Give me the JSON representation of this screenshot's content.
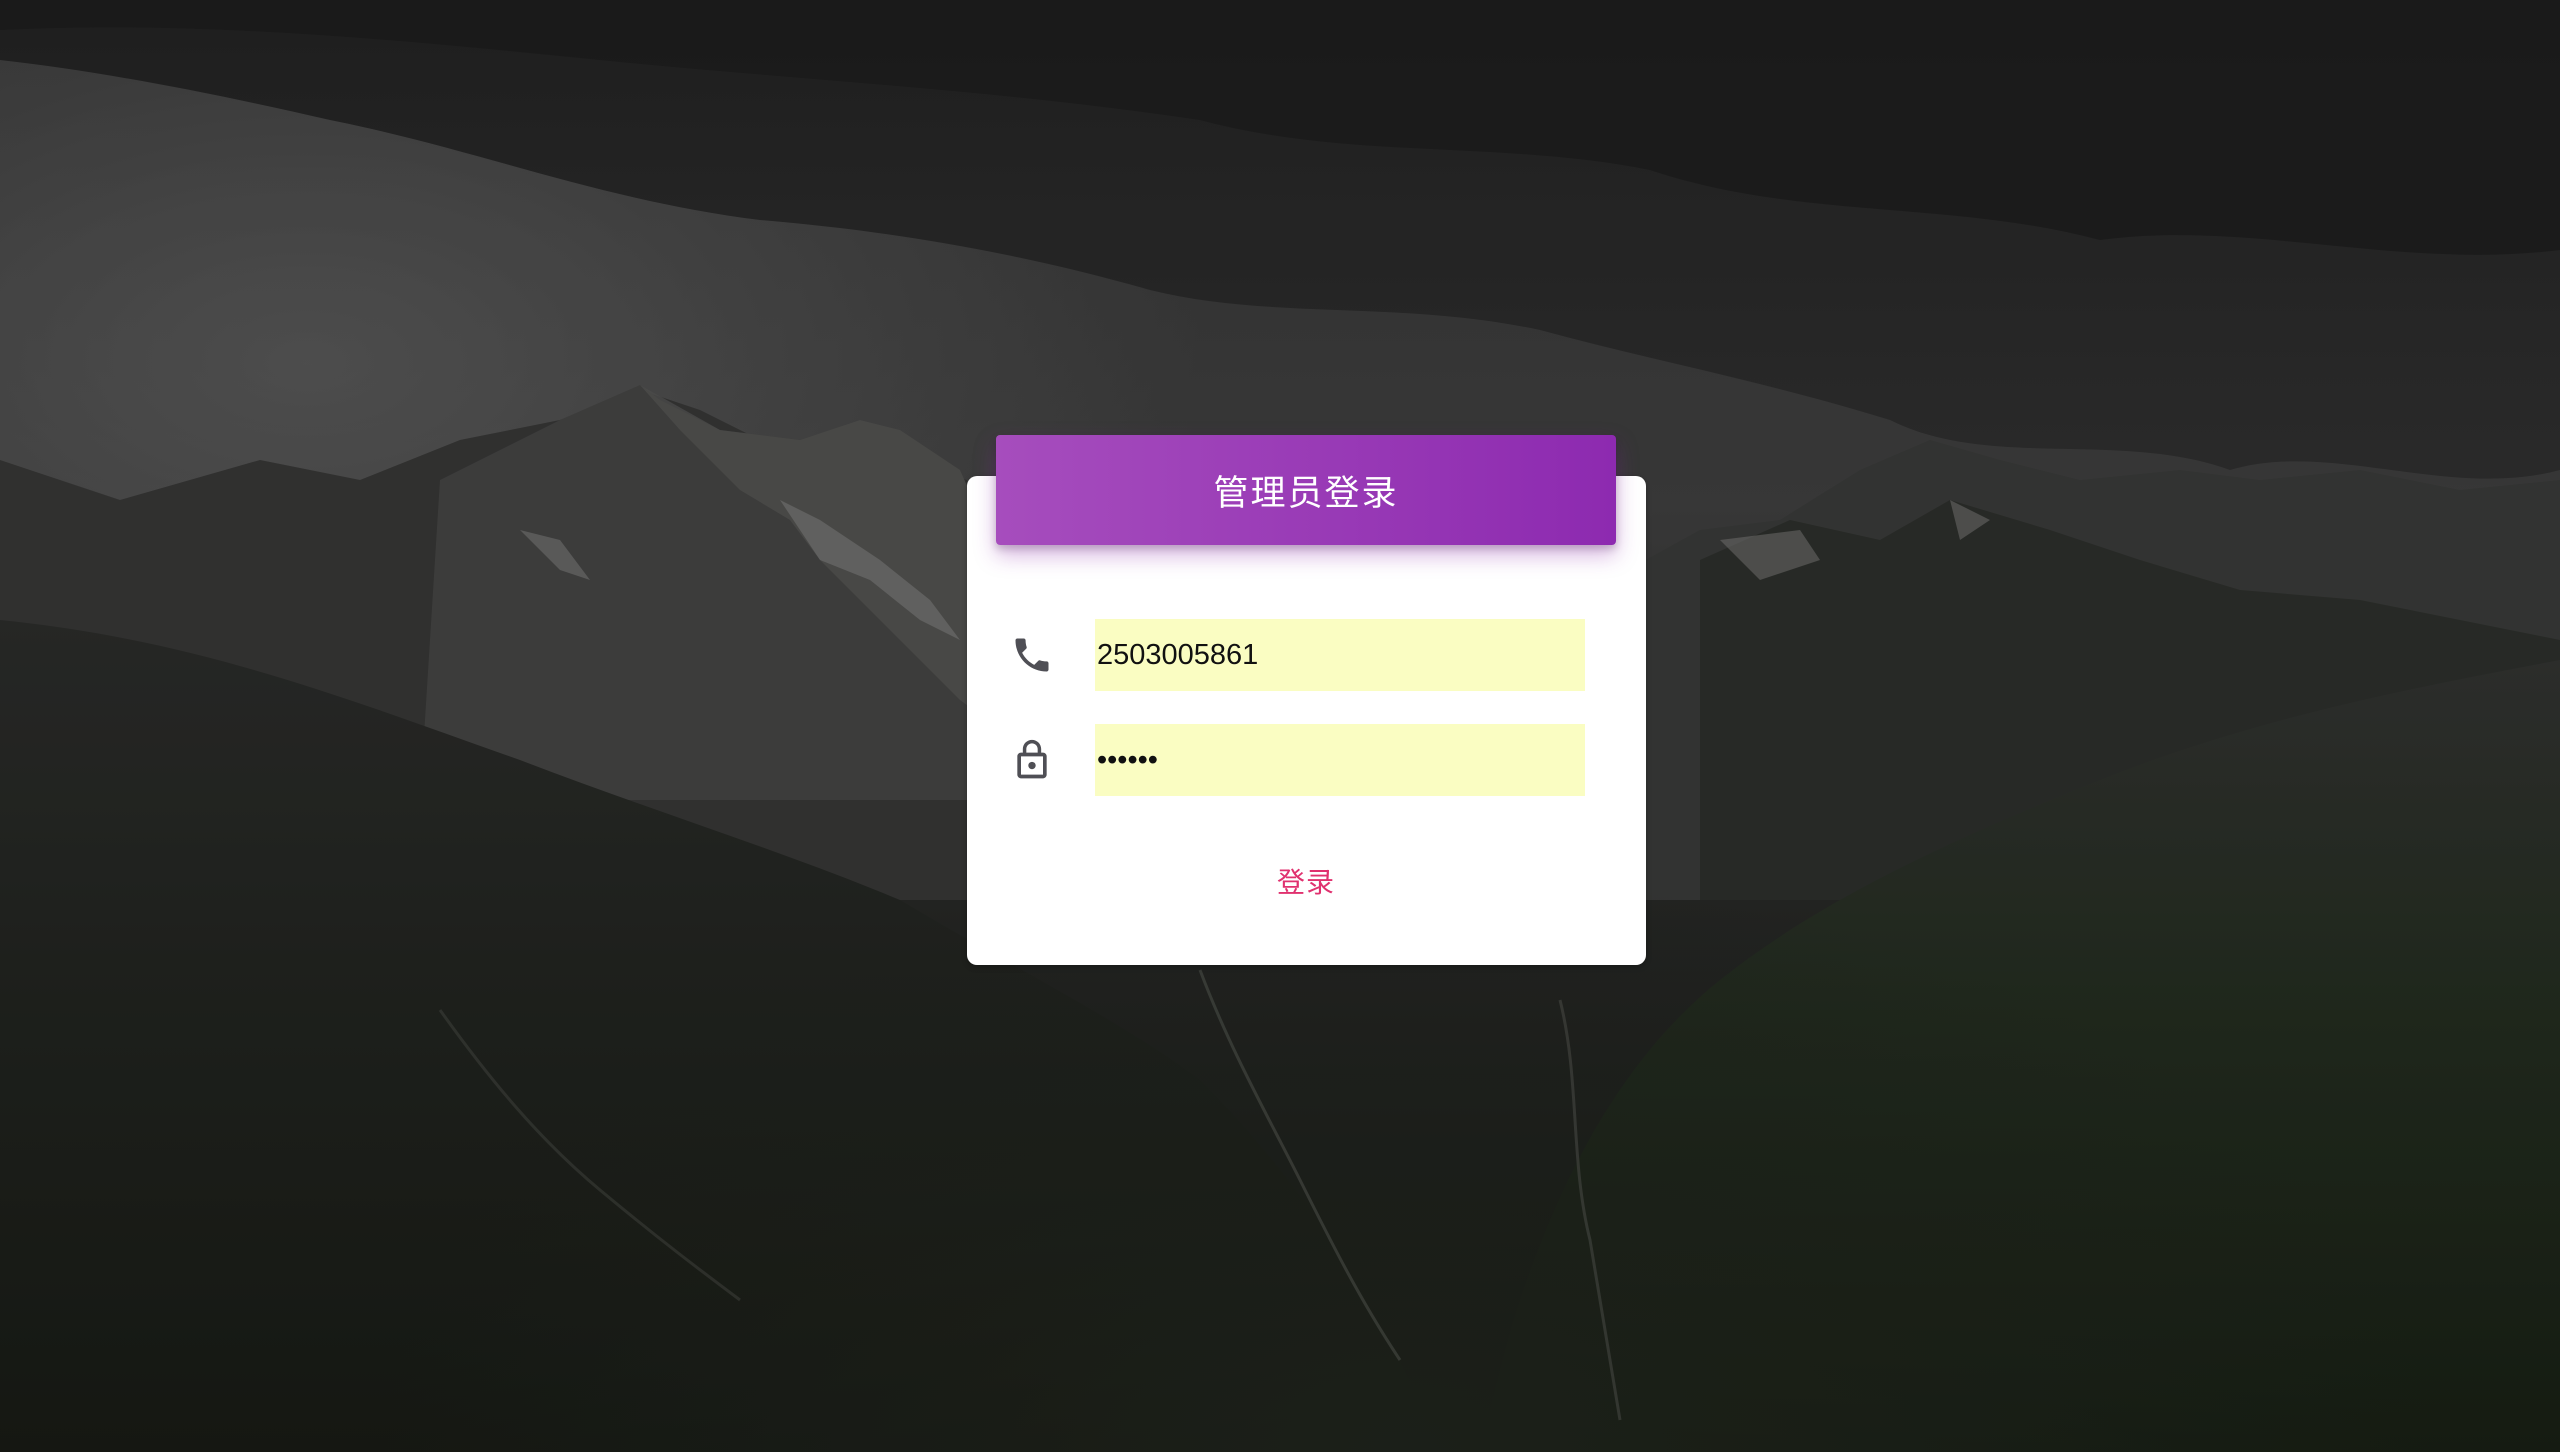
{
  "page": {
    "background": "dark-mountain-clouds"
  },
  "login_card": {
    "title": "管理员登录",
    "header_colors": [
      "#a64dbd",
      "#8d2ab0"
    ],
    "phone_field": {
      "icon": "phone-icon",
      "value": "2503005861",
      "fill_color": "#fafdc2"
    },
    "password_field": {
      "icon": "lock-icon",
      "value": "••••••",
      "fill_color": "#fafdc2"
    },
    "submit_label": "登录",
    "submit_color": "#e0316f"
  }
}
